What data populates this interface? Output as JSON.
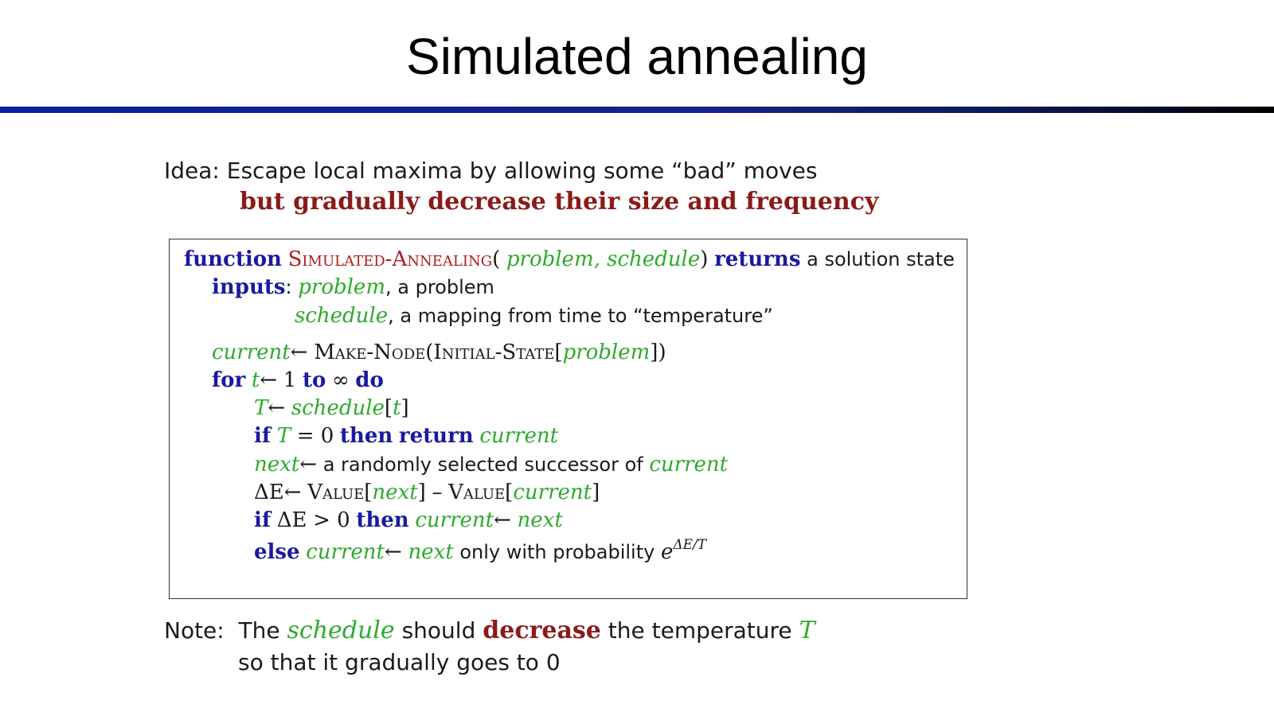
{
  "title": "Simulated annealing",
  "idea": {
    "label": "Idea:",
    "text": "Escape local maxima by allowing some “bad” moves",
    "emphasis": "but gradually decrease their size and frequency"
  },
  "algorithm": {
    "line1": {
      "kw_function": "function",
      "name": "Simulated-Annealing",
      "open": "(",
      "params": "problem, schedule",
      "close": ")",
      "kw_returns": "returns",
      "rest": "a solution state"
    },
    "line2": {
      "kw_inputs": "inputs",
      "colon": ":",
      "var": "problem",
      "rest": ", a problem"
    },
    "line3": {
      "var": "schedule",
      "rest": ", a mapping from time to “temperature”"
    },
    "line4": {
      "var_current": "current",
      "arrow": "←",
      "make_node": "Make-Node",
      "open": "(",
      "initial_state": "Initial-State",
      "lb": "[",
      "var_problem": "problem",
      "rb": "])"
    },
    "line5": {
      "kw_for": "for",
      "var_t": "t",
      "arrow": "←",
      "one": "1",
      "kw_to": "to",
      "infinity": "∞",
      "kw_do": "do"
    },
    "line6": {
      "var_T": "T",
      "arrow": "←",
      "var_schedule": "schedule",
      "lb": "[",
      "var_t": "t",
      "rb": "]"
    },
    "line7": {
      "kw_if": "if",
      "var_T": "T",
      "eq": "= 0",
      "kw_then": "then",
      "kw_return": "return",
      "var_current": "current"
    },
    "line8": {
      "var_next": "next",
      "arrow": "←",
      "text": "a randomly selected successor of",
      "var_current": "current"
    },
    "line9": {
      "delta_e": "ΔE",
      "arrow": "←",
      "value1": "Value",
      "lb1": "[",
      "var_next": "next",
      "rb1": "]",
      "minus": "–",
      "value2": "Value",
      "lb2": "[",
      "var_current": "current",
      "rb2": "]"
    },
    "line10": {
      "kw_if": "if",
      "delta_e": "ΔE",
      "gt": "> 0",
      "kw_then": "then",
      "var_current": "current",
      "arrow": "←",
      "var_next": "next"
    },
    "line11": {
      "kw_else": "else",
      "var_current": "current",
      "arrow": "←",
      "var_next": "next",
      "text": "only with probability",
      "e": "e",
      "exponent": "ΔE/T"
    }
  },
  "note": {
    "label": "Note:",
    "the": "The",
    "schedule": "schedule",
    "should": "should",
    "decrease": "decrease",
    "the_temperature": "the temperature",
    "T": "T",
    "line2": "so that it gradually goes to 0"
  },
  "colors": {
    "keyword": "#1a1aa0",
    "variable": "#2eaa2e",
    "function_name": "#b01c1c",
    "emphasis": "#8b1a1a",
    "rule_start": "#0a1f9e",
    "rule_end": "#000000"
  }
}
